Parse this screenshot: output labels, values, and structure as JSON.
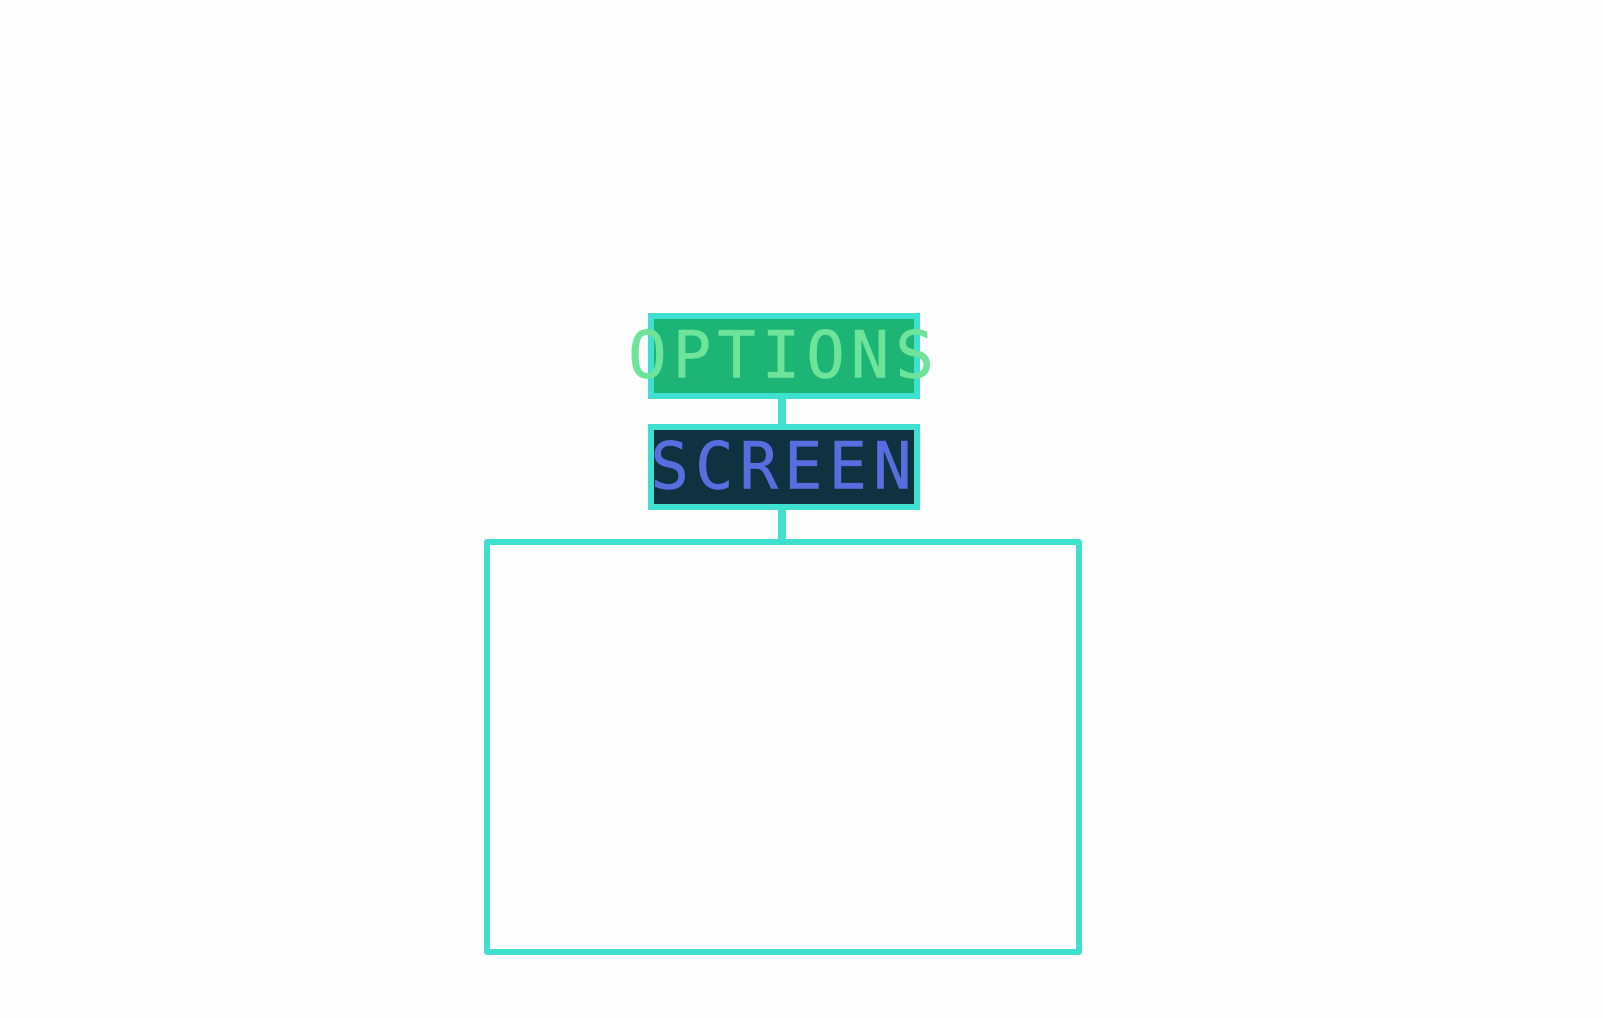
{
  "menu": {
    "options_label": "OPTIONS",
    "screen_label": "SCREEN"
  },
  "colors": {
    "border": "#40e0d0",
    "options_bg": "#1db575",
    "options_text": "#6ee39a",
    "screen_bg": "#10313f",
    "screen_text": "#5a6ddf",
    "background": "#fefefe"
  }
}
